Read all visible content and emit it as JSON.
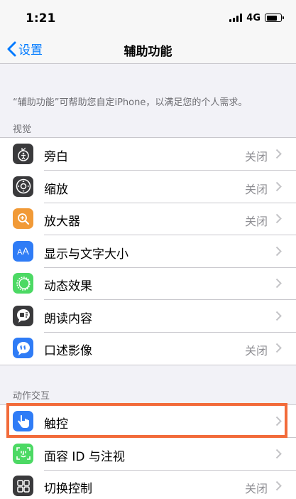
{
  "status_bar": {
    "time": "1:21",
    "network": "4G"
  },
  "nav": {
    "back_label": "设置",
    "title": "辅助功能"
  },
  "intro_text": "“辅助功能”可帮助您自定iPhone，以满足您的个人需求。",
  "sections": {
    "vision": {
      "header": "视觉",
      "items": [
        {
          "label": "旁白",
          "value": "关闭",
          "icon": "voiceover-icon",
          "color": "#3a3a3c"
        },
        {
          "label": "缩放",
          "value": "关闭",
          "icon": "zoom-icon",
          "color": "#3a3a3c"
        },
        {
          "label": "放大器",
          "value": "关闭",
          "icon": "magnifier-icon",
          "color": "#f19a37"
        },
        {
          "label": "显示与文字大小",
          "value": "",
          "icon": "text-size-icon",
          "color": "#2f7cf6"
        },
        {
          "label": "动态效果",
          "value": "",
          "icon": "motion-icon",
          "color": "#4cd964"
        },
        {
          "label": "朗读内容",
          "value": "",
          "icon": "spoken-content-icon",
          "color": "#3a3a3c"
        },
        {
          "label": "口述影像",
          "value": "关闭",
          "icon": "audio-description-icon",
          "color": "#2f7cf6"
        }
      ]
    },
    "interaction": {
      "header": "动作交互",
      "items": [
        {
          "label": "触控",
          "value": "",
          "icon": "touch-icon",
          "color": "#2f7cf6"
        },
        {
          "label": "面容 ID 与注视",
          "value": "",
          "icon": "face-id-icon",
          "color": "#4cd964"
        },
        {
          "label": "切换控制",
          "value": "关闭",
          "icon": "switch-control-icon",
          "color": "#3a3a3c"
        }
      ]
    }
  },
  "highlight_color": "#f26b3a",
  "accent_color": "#007aff"
}
